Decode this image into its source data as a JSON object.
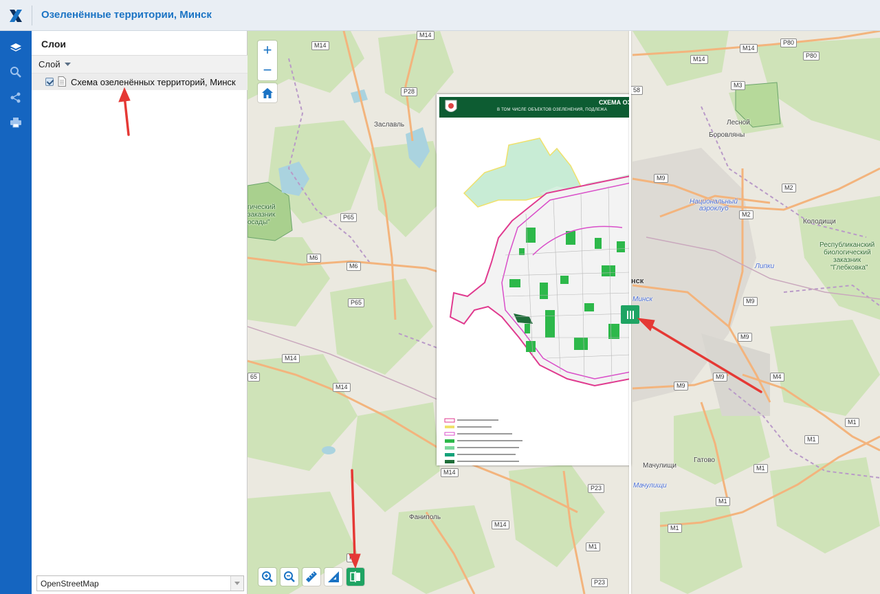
{
  "header": {
    "title": "Озеленённые территории, Минск"
  },
  "toolstrip": {
    "items": [
      "layers-icon",
      "search-icon",
      "share-icon",
      "print-icon"
    ]
  },
  "layers_panel": {
    "title": "Слои",
    "menu_label": "Слой",
    "layers": [
      {
        "label": "Схема озеленённых территорий, Минск",
        "checked": true
      }
    ],
    "basemap": {
      "selected": "OpenStreetMap"
    }
  },
  "map": {
    "zoom_in": "+",
    "zoom_out": "−",
    "scheme": {
      "title": "СХЕМА ОЗ",
      "subtitle": "В ТОМ ЧИСЛЕ ОБЪЕКТОВ ОЗЕЛЕНЕНИЯ, ПОДЛЕЖА"
    },
    "road_labels": {
      "m14_a": "M14",
      "m14_b": "M14",
      "p28": "P28",
      "p65_a": "P65",
      "m6_a": "M6",
      "m6_b": "M6",
      "p65_b": "P65",
      "m14_c": "M14",
      "m14_d": "M14",
      "p65_c": "65",
      "m14_e": "M14",
      "m14_f": "M14",
      "p23": "P23",
      "m1_a": "M1",
      "p23_b": "P23",
      "p8": "P",
      "m14_r1": "M14",
      "m14_r2": "M14",
      "p80_a": "P80",
      "p80_b": "P80",
      "m3": "M3",
      "m9_a": "M9",
      "m2_a": "M2",
      "m2_b": "M2",
      "m9_b": "M9",
      "m9_c": "M9",
      "m9_d": "M9",
      "m9_e": "M9",
      "m4": "M4",
      "m1_b": "M1",
      "m1_c": "M1",
      "m1_d": "M1",
      "m1_e": "M1",
      "m1_f": "M1",
      "p58": "58"
    },
    "places": {
      "zaslavl": "Заславль",
      "fanipol": "Фаниполь",
      "lesnoy": "Лесной",
      "borovlyany": "Боровляны",
      "natsionalny_1": "Национальный",
      "natsionalny_2": "аэроклуб",
      "kolodishchi": "Колодищи",
      "lipki": "Липки",
      "minsk": "нск",
      "minsk_blue": "Минск",
      "gatovo": "Гатово",
      "machulishchi": "Мачулищи",
      "machulishchi_blue": "Мачулищи",
      "reserve_1": "Республиканский",
      "reserve_2": "биологический",
      "reserve_3": "заказник",
      "reserve_4": "\"Глебковка\"",
      "left_reserve_1": "гический",
      "left_reserve_2": "заказник",
      "left_reserve_3": "осады\""
    },
    "bottom_tools": [
      "zoom-in-tool-icon",
      "zoom-out-tool-icon",
      "measure-length-icon",
      "measure-area-icon",
      "swipe-compare-icon"
    ]
  },
  "colors": {
    "brand_blue": "#1565c0",
    "accent_green": "#1fa463",
    "scheme_header_green": "#0d5c32",
    "annotation_red": "#e53935"
  }
}
